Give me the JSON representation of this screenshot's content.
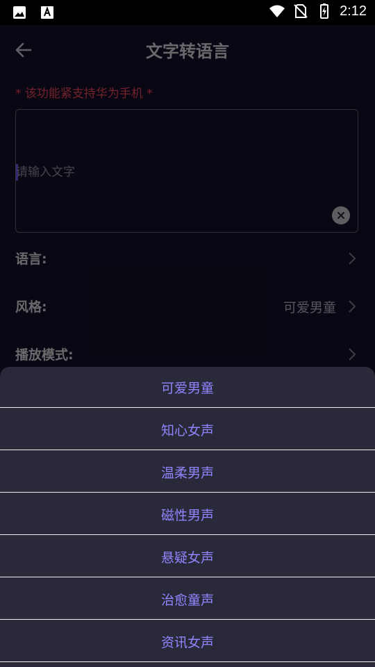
{
  "status_bar": {
    "time": "2:12",
    "icons_left": [
      "image-icon",
      "text-a-icon"
    ],
    "icons_right": [
      "wifi-icon",
      "no-sim-icon",
      "battery-charging-icon"
    ]
  },
  "header": {
    "title": "文字转语言",
    "back_icon": "back-arrow-icon"
  },
  "notice": "* 该功能紧支持华为手机 *",
  "text_input": {
    "value": "",
    "placeholder": "请输入文字",
    "clear_icon": "clear-circle-icon"
  },
  "settings": [
    {
      "label": "语言:",
      "value": ""
    },
    {
      "label": "风格:",
      "value": "可爱男童"
    },
    {
      "label": "播放模式:",
      "value": ""
    }
  ],
  "sheet": {
    "options": [
      "可爱男童",
      "知心女声",
      "温柔男声",
      "磁性男声",
      "悬疑女声",
      "治愈童声",
      "资讯女声"
    ]
  },
  "colors": {
    "background": "#14112a",
    "accent": "#8f86ff",
    "notice": "#ff4a5e",
    "sheet": "#2a2939"
  }
}
